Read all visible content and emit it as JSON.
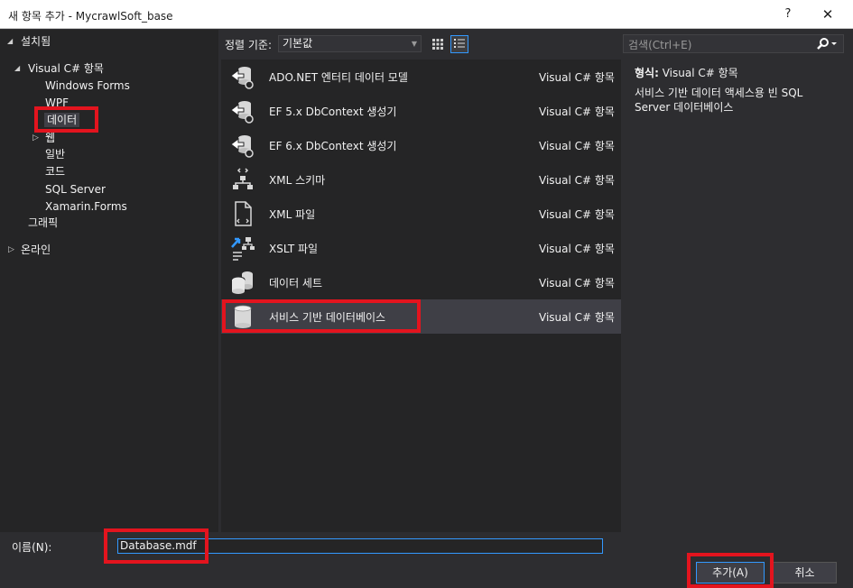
{
  "window": {
    "title": "새 항목 추가 - MycrawlSoft_base",
    "help_glyph": "?",
    "close_glyph": "✕"
  },
  "tree": {
    "installed": "설치됨",
    "visual_csharp": "Visual C# 항목",
    "children": [
      "Windows Forms",
      "WPF",
      "데이터",
      "웹",
      "일반",
      "코드",
      "SQL Server",
      "Xamarin.Forms"
    ],
    "graphics": "그래픽",
    "online": "온라인"
  },
  "toolbar": {
    "sort_label": "정렬 기준:",
    "sort_value": "기본값",
    "search_placeholder": "검색(Ctrl+E)"
  },
  "templates": [
    {
      "name": "ADO.NET 엔터티 데이터 모델",
      "type": "Visual C# 항목",
      "icon": "entity-model-icon"
    },
    {
      "name": "EF 5.x DbContext 생성기",
      "type": "Visual C# 항목",
      "icon": "dbcontext-generator-icon"
    },
    {
      "name": "EF 6.x DbContext 생성기",
      "type": "Visual C# 항목",
      "icon": "dbcontext-generator-icon"
    },
    {
      "name": "XML 스키마",
      "type": "Visual C# 항목",
      "icon": "xml-schema-icon"
    },
    {
      "name": "XML 파일",
      "type": "Visual C# 항목",
      "icon": "xml-file-icon"
    },
    {
      "name": "XSLT 파일",
      "type": "Visual C# 항목",
      "icon": "xslt-file-icon"
    },
    {
      "name": "데이터 세트",
      "type": "Visual C# 항목",
      "icon": "dataset-icon"
    },
    {
      "name": "서비스 기반 데이터베이스",
      "type": "Visual C# 항목",
      "icon": "database-icon"
    }
  ],
  "detail": {
    "type_label": "형식:",
    "type_value": "Visual C# 항목",
    "description": "서비스 기반 데이터 액세스용 빈 SQL Server 데이터베이스"
  },
  "bottom": {
    "name_label": "이름(N):",
    "name_value": "Database.mdf",
    "add_button": "추가(A)",
    "cancel_button": "취소"
  },
  "colors": {
    "background": "#2d2d30",
    "panel": "#252526",
    "selected_row": "#3f3f46",
    "accent": "#3399ff",
    "highlight": "#e3141e"
  }
}
